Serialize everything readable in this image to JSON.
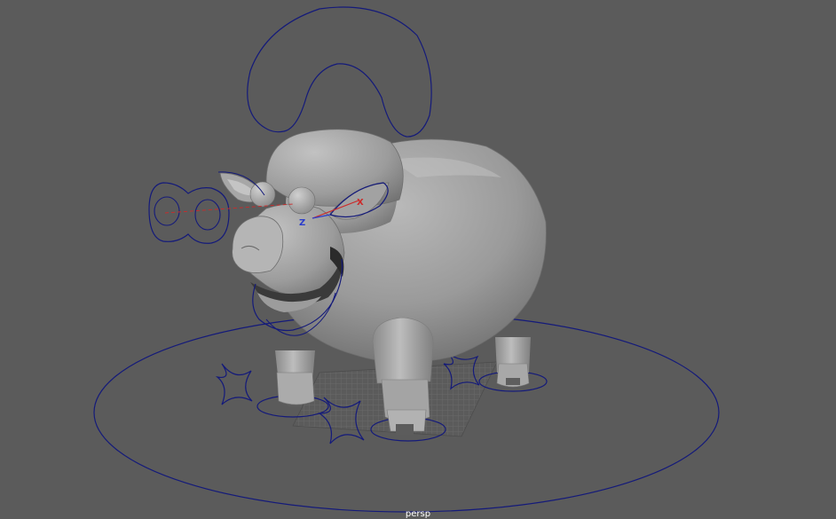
{
  "viewport": {
    "camera_name": "persp",
    "background_color": "#5b5b5b",
    "controller_color": "#141a7a"
  },
  "locator": {
    "x_label": "X",
    "z_label": "Z",
    "x_color": "#cc2a2a",
    "z_color": "#2a3ccc"
  }
}
